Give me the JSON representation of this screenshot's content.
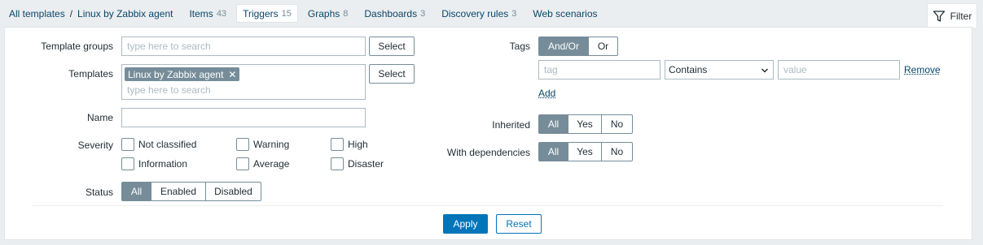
{
  "breadcrumb": {
    "all_templates": "All templates",
    "separator": "/",
    "template": "Linux by Zabbix agent"
  },
  "tabs": [
    {
      "label": "Items",
      "count": "43"
    },
    {
      "label": "Triggers",
      "count": "15"
    },
    {
      "label": "Graphs",
      "count": "8"
    },
    {
      "label": "Dashboards",
      "count": "3"
    },
    {
      "label": "Discovery rules",
      "count": "3"
    },
    {
      "label": "Web scenarios",
      "count": ""
    }
  ],
  "active_tab": "Triggers",
  "filter_tab": {
    "label": "Filter",
    "icon": "filter-icon"
  },
  "form": {
    "template_groups": {
      "label": "Template groups",
      "placeholder": "type here to search",
      "select_label": "Select"
    },
    "templates": {
      "label": "Templates",
      "selected": "Linux by Zabbix agent",
      "remove_glyph": "✕",
      "placeholder": "type here to search",
      "select_label": "Select"
    },
    "name": {
      "label": "Name",
      "value": ""
    },
    "severity": {
      "label": "Severity",
      "options": [
        "Not classified",
        "Warning",
        "High",
        "Information",
        "Average",
        "Disaster"
      ]
    },
    "status": {
      "label": "Status",
      "options": [
        "All",
        "Enabled",
        "Disabled"
      ],
      "selected": "All"
    },
    "tags": {
      "label": "Tags",
      "operators": [
        "And/Or",
        "Or"
      ],
      "selected_operator": "And/Or",
      "tag_placeholder": "tag",
      "condition": "Contains",
      "value_placeholder": "value",
      "remove_label": "Remove",
      "add_label": "Add"
    },
    "inherited": {
      "label": "Inherited",
      "options": [
        "All",
        "Yes",
        "No"
      ],
      "selected": "All"
    },
    "with_dependencies": {
      "label": "With dependencies",
      "options": [
        "All",
        "Yes",
        "No"
      ],
      "selected": "All"
    }
  },
  "actions": {
    "apply": "Apply",
    "reset": "Reset"
  },
  "colors": {
    "accent": "#0275b8",
    "link": "#0a466a",
    "segment_on": "#768d99",
    "background": "#ebeef0"
  }
}
